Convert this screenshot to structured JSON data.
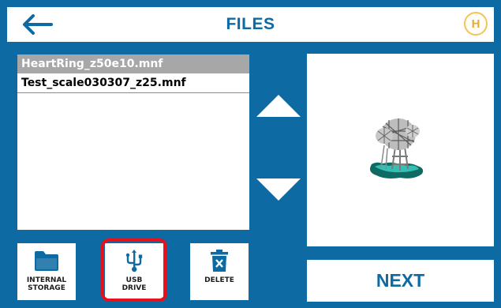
{
  "header": {
    "title": "FILES",
    "back_icon": "arrow-left-icon",
    "logo_text": "H"
  },
  "files": [
    {
      "name": "HeartRing_z50e10.mnf",
      "selected": true
    },
    {
      "name": "Test_scale030307_z25.mnf",
      "selected": false
    }
  ],
  "nav": {
    "up_icon": "triangle-up-icon",
    "down_icon": "triangle-down-icon"
  },
  "preview": {
    "icon": "3d-model-preview"
  },
  "toolbar": {
    "internal_label": "INTERNAL\nSTORAGE",
    "internal_icon": "folder-icon",
    "usb_label": "USB\nDRIVE",
    "usb_icon": "usb-icon",
    "delete_label": "DELETE",
    "delete_icon": "trash-icon"
  },
  "next_label": "NEXT",
  "colors": {
    "background": "#0e6aa3",
    "accent": "#0e6aa3",
    "selected_row": "#a7a7a7",
    "highlight": "#e8101a",
    "logo": "#f3c55a"
  }
}
